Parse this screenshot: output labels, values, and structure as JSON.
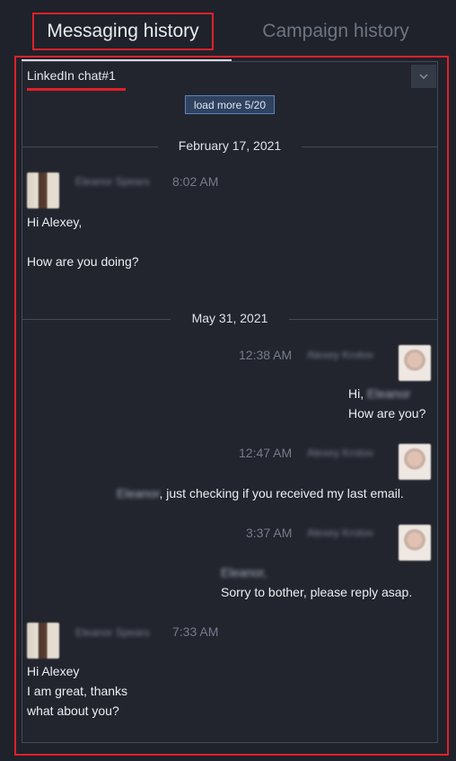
{
  "tabs": [
    {
      "label": "Messaging history",
      "active": true
    },
    {
      "label": "Campaign history",
      "active": false
    }
  ],
  "chat": {
    "selected": "LinkedIn chat#1",
    "load_more": "load more 5/20"
  },
  "dates": [
    "February 17, 2021",
    "May 31, 2021"
  ],
  "messages": [
    {
      "sender": "Eleanor Spears",
      "time": "8:02 AM",
      "lines": [
        "Hi Alexey,",
        "",
        "How are you doing?"
      ]
    },
    {
      "sender": "Alexey Krotov",
      "time": "12:38 AM",
      "greeting": "Hi,",
      "mention": "Eleanor",
      "line2": "How are you?"
    },
    {
      "sender": "Alexey Krotov",
      "time": "12:47 AM",
      "mention": "Eleanor",
      "text": ", just checking if you received my last email."
    },
    {
      "sender": "Alexey Krotov",
      "time": "3:37 AM",
      "mention": "Eleanor,",
      "text": "Sorry to bother, please reply asap."
    },
    {
      "sender": "Eleanor Spears",
      "time": "7:33 AM",
      "lines": [
        "Hi Alexey",
        "I am great, thanks",
        "what about you?"
      ]
    }
  ],
  "colors": {
    "accent_red": "#e0202a",
    "background": "#1f222a",
    "button_blue": "#2f4260"
  }
}
